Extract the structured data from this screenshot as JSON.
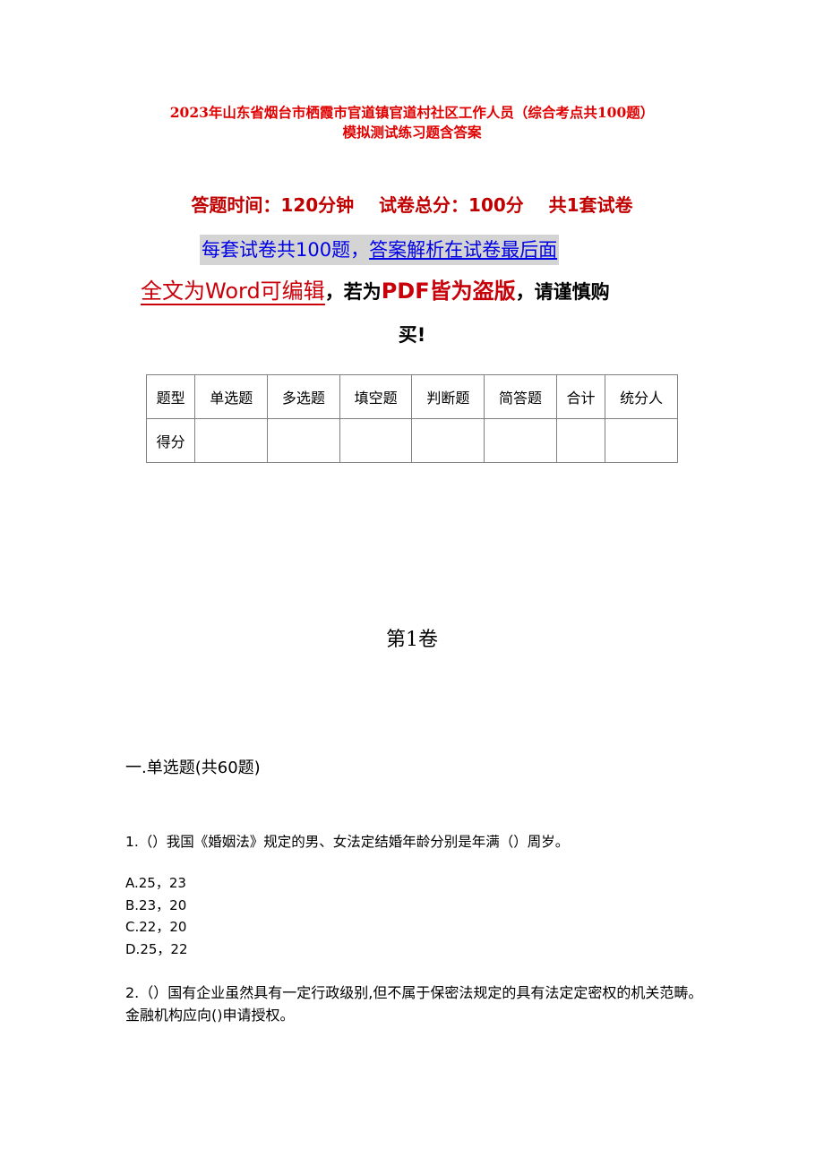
{
  "document": {
    "title_line1": "2023年山东省烟台市栖霞市官道镇官道村社区工作人员（综合考点共100题）",
    "title_line2": "模拟测试练习题含答案",
    "info_line": "答题时间：120分钟    试卷总分：100分    共1套试卷",
    "banner": {
      "part1": "每套试卷共100题，",
      "part2": "答案解析在试卷最后面"
    },
    "notice": {
      "red_underlined": "全文为Word可编辑",
      "comma1": "，若为",
      "pdf": "PDF皆为盗版",
      "rest": "，请谨慎购",
      "line2": "买!"
    },
    "score_table": {
      "header": [
        "题型",
        "单选题",
        "多选题",
        "填空题",
        "判断题",
        "简答题",
        "合计",
        "统分人"
      ],
      "row": [
        "得分",
        "",
        "",
        "",
        "",
        "",
        "",
        ""
      ]
    },
    "volume_title": "第1卷",
    "section_title": "一.单选题(共60题)",
    "questions": [
      {
        "text": "1.（）我国《婚姻法》规定的男、女法定结婚年龄分别是年满（）周岁。",
        "options": [
          "A.25，23",
          "B.23，20",
          "C.22，20",
          "D.25，22"
        ]
      },
      {
        "text": "2.（）国有企业虽然具有一定行政级别,但不属于保密法规定的具有法定定密权的机关范畴。金融机构应向()申请授权。",
        "options": []
      }
    ],
    "colors": {
      "title_red": "#e00000",
      "notice_red": "#c8000a",
      "banner_blue": "#0000e6",
      "banner_bg": "#d4d4d4"
    }
  }
}
